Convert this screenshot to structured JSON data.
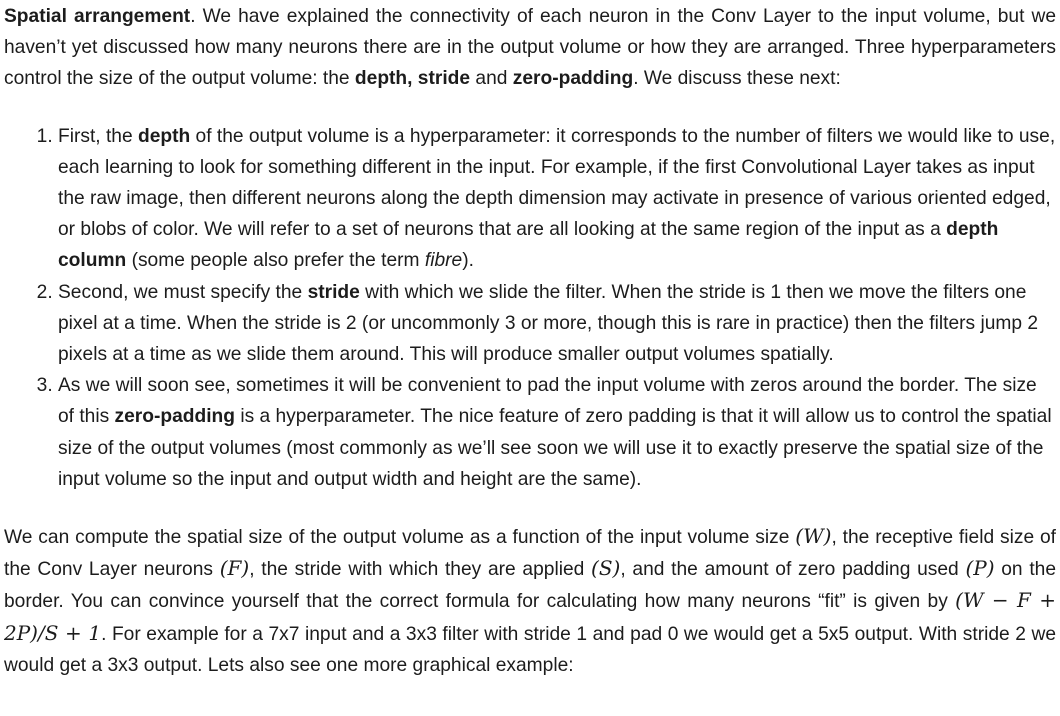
{
  "intro": {
    "heading": "Spatial arrangement",
    "sentence1": ". We have explained the connectivity of each neuron in the Conv Layer to the input volume, but we haven’t yet discussed how many neurons there are in the output volume or how they are arranged. Three hyperparameters control the size of the output volume: the ",
    "bold_terms": "depth, stride",
    "and": " and ",
    "bold_zero": "zero-padding",
    "tail": ". We discuss these next:"
  },
  "list": {
    "item1": {
      "a": "First, the ",
      "b_depth": "depth",
      "c": " of the output volume is a hyperparameter: it corresponds to the number of filters we would like to use, each learning to look for something different in the input. For example, if the first Convolutional Layer takes as input the raw image, then different neurons along the depth dimension may activate in presence of various oriented edged, or blobs of color. We will refer to a set of neurons that are all looking at the same region of the input as a ",
      "b_column": "depth column",
      "d": " (some people also prefer the term ",
      "i_fibre": "fibre",
      "e": ")."
    },
    "item2": {
      "a": "Second, we must specify the ",
      "b_stride": "stride",
      "c": " with which we slide the filter. When the stride is 1 then we move the filters one pixel at a time. When the stride is 2 (or uncommonly 3 or more, though this is rare in practice) then the filters jump 2 pixels at a time as we slide them around. This will produce smaller output volumes spatially."
    },
    "item3": {
      "a": "As we will soon see, sometimes it will be convenient to pad the input volume with zeros around the border. The size of this ",
      "b_zero": "zero-padding",
      "c": " is a hyperparameter. The nice feature of zero padding is that it will allow us to control the spatial size of the output volumes (most commonly as we’ll see soon we will use it to exactly preserve the spatial size of the input volume so the input and output width and height are the same)."
    }
  },
  "formula_para": {
    "t1": "We can compute the spatial size of the output volume as a function of the input volume size ",
    "m_w": "(W)",
    "t2": ", the receptive field size of the Conv Layer neurons ",
    "m_f": "(F)",
    "t3": ", the stride with which they are applied ",
    "m_s": "(S)",
    "t4": ", and the amount of zero padding used ",
    "m_p": "(P)",
    "t5": " on the border. You can convince yourself that the correct formula for calculating how many neurons “fit” is given by ",
    "m_formula": "(W − F + 2P)/S + 1",
    "t6": ". For example for a 7x7 input and a 3x3 filter with stride 1 and pad 0 we would get a 5x5 output. With stride 2 we would get a 3x3 output. Lets also see one more graphical example:"
  }
}
